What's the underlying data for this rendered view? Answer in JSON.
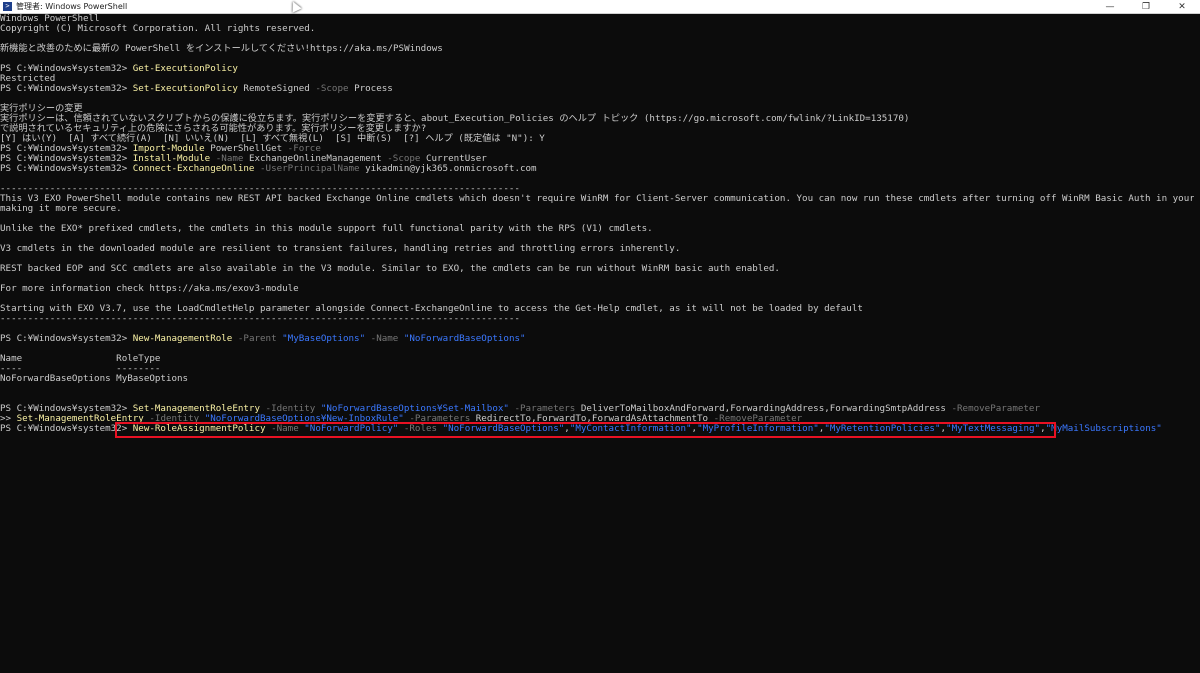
{
  "window": {
    "title": "管理者: Windows PowerShell",
    "minimize": "—",
    "maximize": "❐",
    "close": "✕"
  },
  "console": {
    "l00": "Windows PowerShell",
    "l01": "Copyright (C) Microsoft Corporation. All rights reserved.",
    "l03": "新機能と改善のために最新の PowerShell をインストールしてください!https://aka.ms/PSWindows",
    "l05_prompt": "PS C:¥Windows¥system32> ",
    "l05_cmd": "Get-ExecutionPolicy",
    "l06": "Restricted",
    "l07_prompt": "PS C:¥Windows¥system32> ",
    "l07_cmd": "Set-ExecutionPolicy",
    "l07_a1": " RemoteSigned ",
    "l07_p1": "-Scope",
    "l07_a2": " Process",
    "l09": "実行ポリシーの変更",
    "l10": "実行ポリシーは、信頼されていないスクリプトからの保護に役立ちます。実行ポリシーを変更すると、about_Execution_Policies のヘルプ トピック (https://go.microsoft.com/fwlink/?LinkID=135170)",
    "l11": "で説明されているセキュリティ上の危険にさらされる可能性があります。実行ポリシーを変更しますか?",
    "l12_opts": "[Y] はい(Y)  [A] すべて続行(A)  [N] いいえ(N)  [L] すべて無視(L)  [S] 中断(S)  [?] ヘルプ (既定値は \"N\"): ",
    "l12_answer": "Y",
    "l13_prompt": "PS C:¥Windows¥system32> ",
    "l13_cmd": "Import-Module",
    "l13_a1": " PowerShellGet ",
    "l13_p1": "-Force",
    "l14_prompt": "PS C:¥Windows¥system32> ",
    "l14_cmd": "Install-Module",
    "l14_p1": " -Name",
    "l14_a1": " ExchangeOnlineManagement ",
    "l14_p2": "-Scope",
    "l14_a2": " CurrentUser",
    "l15_prompt": "PS C:¥Windows¥system32> ",
    "l15_cmd": "Connect-ExchangeOnline",
    "l15_p1": " -UserPrincipalName",
    "l15_a1": " yikadmin@yjk365.onmicrosoft.com",
    "l17": "----------------------------------------------------------------------------------------------",
    "l18": "This V3 EXO PowerShell module contains new REST API backed Exchange Online cmdlets which doesn't require WinRM for Client-Server communication. You can now run these cmdlets after turning off WinRM Basic Auth in your client machine thus",
    "l19": "making it more secure.",
    "l21": "Unlike the EXO* prefixed cmdlets, the cmdlets in this module support full functional parity with the RPS (V1) cmdlets.",
    "l23": "V3 cmdlets in the downloaded module are resilient to transient failures, handling retries and throttling errors inherently.",
    "l25": "REST backed EOP and SCC cmdlets are also available in the V3 module. Similar to EXO, the cmdlets can be run without WinRM basic auth enabled.",
    "l27": "For more information check https://aka.ms/exov3-module",
    "l29": "Starting with EXO V3.7, use the LoadCmdletHelp parameter alongside Connect-ExchangeOnline to access the Get-Help cmdlet, as it will not be loaded by default",
    "l30": "----------------------------------------------------------------------------------------------",
    "l32_prompt": "PS C:¥Windows¥system32> ",
    "l32_cmd": "New-ManagementRole",
    "l32_p1": " -Parent",
    "l32_s1": " \"MyBaseOptions\"",
    "l32_p2": " -Name",
    "l32_s2": " \"NoForwardBaseOptions\"",
    "l34": "Name                 RoleType",
    "l35": "----                 --------",
    "l36": "NoForwardBaseOptions MyBaseOptions",
    "l39_prompt": "PS C:¥Windows¥system32> ",
    "l39_cmd": "Set-ManagementRoleEntry",
    "l39_p1": " -Identity",
    "l39_s1": " \"NoForwardBaseOptions¥Set-Mailbox\"",
    "l39_p2": " -Parameters",
    "l39_a1": " DeliverToMailboxAndForward,ForwardingAddress,ForwardingSmtpAddress ",
    "l39_p3": "-RemoveParameter",
    "l40_prompt": ">> ",
    "l40_cmd": "Set-ManagementRoleEntry",
    "l40_p1": " -Identity",
    "l40_s1": " \"NoForwardBaseOptions¥New-InboxRule\"",
    "l40_p2": " -Parameters",
    "l40_a1": " RedirectTo,ForwardTo,ForwardAsAttachmentTo ",
    "l40_p3": "-RemoveParameter",
    "l41_prompt": "PS C:¥Windows¥system32> ",
    "l41_cmd": "New-RoleAssignmentPolicy",
    "l41_p1": " -Name",
    "l41_s1": " \"NoForwardPolicy\"",
    "l41_p2": " -Roles",
    "l41_s2": " \"NoForwardBaseOptions\"",
    "l41_c1": ",",
    "l41_s3": "\"MyContactInformation\"",
    "l41_c2": ",",
    "l41_s4": "\"MyProfileInformation\"",
    "l41_c3": ",",
    "l41_s5": "\"MyRetentionPolicies\"",
    "l41_c4": ",",
    "l41_s6": "\"MyTextMessaging\"",
    "l41_c5": ",",
    "l41_s7": "\"MyMailSubscriptions\""
  }
}
